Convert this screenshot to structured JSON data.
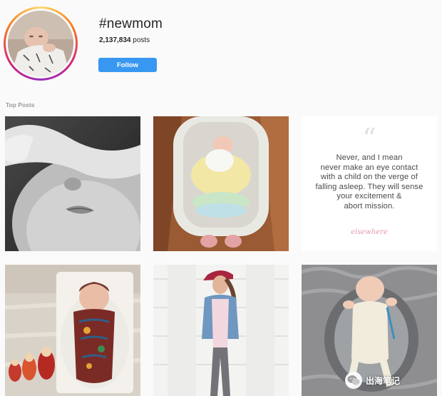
{
  "header": {
    "hashtag": "#newmom",
    "post_count": "2,137,834",
    "post_count_suffix": " posts",
    "follow_label": "Follow"
  },
  "section": {
    "top_posts_label": "Top Posts"
  },
  "posts": [
    {
      "type": "photo",
      "subject": "black-and-white close-up of baby face with arm over eyes"
    },
    {
      "type": "photo",
      "subject": "newborn sleeping in bassinet on wooden floor"
    },
    {
      "type": "quote",
      "quote_lines": [
        "Never, and I mean",
        "never make an eye contact",
        "with a child on the verge of",
        "falling asleep. They will sense",
        "your excitement &",
        "abort mission."
      ],
      "signature": "elsewhere"
    },
    {
      "type": "photo",
      "subject": "swaddled newborn in floral blanket with nesting dolls"
    },
    {
      "type": "photo",
      "subject": "woman in cap and denim shirt standing by white garage door"
    },
    {
      "type": "photo",
      "subject": "baby lying in grey lounger on fluffy rug"
    }
  ],
  "watermark": {
    "text": "出海笔记"
  },
  "colors": {
    "accent": "#3897f0",
    "page_background": "#fafafa",
    "quote_signature": "#e59aa9"
  }
}
